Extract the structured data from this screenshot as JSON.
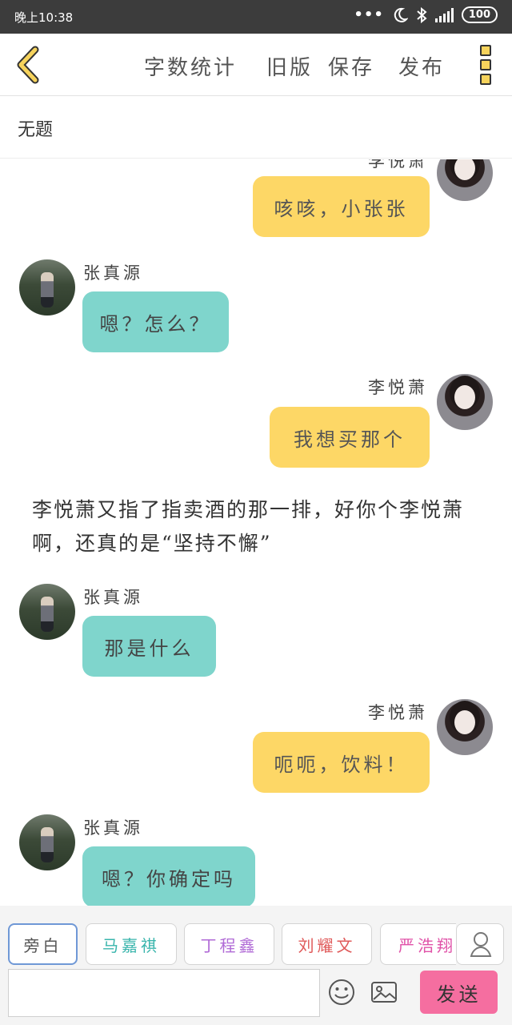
{
  "status_bar": {
    "time": "晚上10:38",
    "network": "4G",
    "battery": "100"
  },
  "toolbar": {
    "buttons": [
      "字数统计",
      "旧版",
      "保存",
      "发布"
    ],
    "accent_color": "#f6d35c"
  },
  "document": {
    "title": "无题"
  },
  "chat": {
    "top_partial_name": "李悦萧",
    "messages": [
      {
        "name": "",
        "text": "咳咳，小张张"
      },
      {
        "name": "张真源",
        "text": "嗯？怎么？"
      },
      {
        "name": "李悦萧",
        "text": "我想买那个"
      },
      {
        "name": "张真源",
        "text": "那是什么"
      },
      {
        "name": "李悦萧",
        "text": "呃呃，饮料！"
      },
      {
        "name": "张真源",
        "text": "嗯？你确定吗"
      }
    ],
    "narration": "李悦萧又指了指卖酒的那一排，好你个李悦萧啊，还真的是“坚持不懈”"
  },
  "characters": [
    {
      "label": "旁白",
      "color": "#555555"
    },
    {
      "label": "马嘉祺",
      "color": "#39b5ac"
    },
    {
      "label": "丁程鑫",
      "color": "#b06ad6"
    },
    {
      "label": "刘耀文",
      "color": "#e05a5a"
    },
    {
      "label": "严浩翔",
      "color": "#e052a8"
    }
  ],
  "composer": {
    "placeholder": "",
    "send_label": "发送"
  },
  "colors": {
    "yellow_bubble": "#fdd766",
    "teal_bubble": "#7fd5cc",
    "send_button": "#f56ea0"
  }
}
